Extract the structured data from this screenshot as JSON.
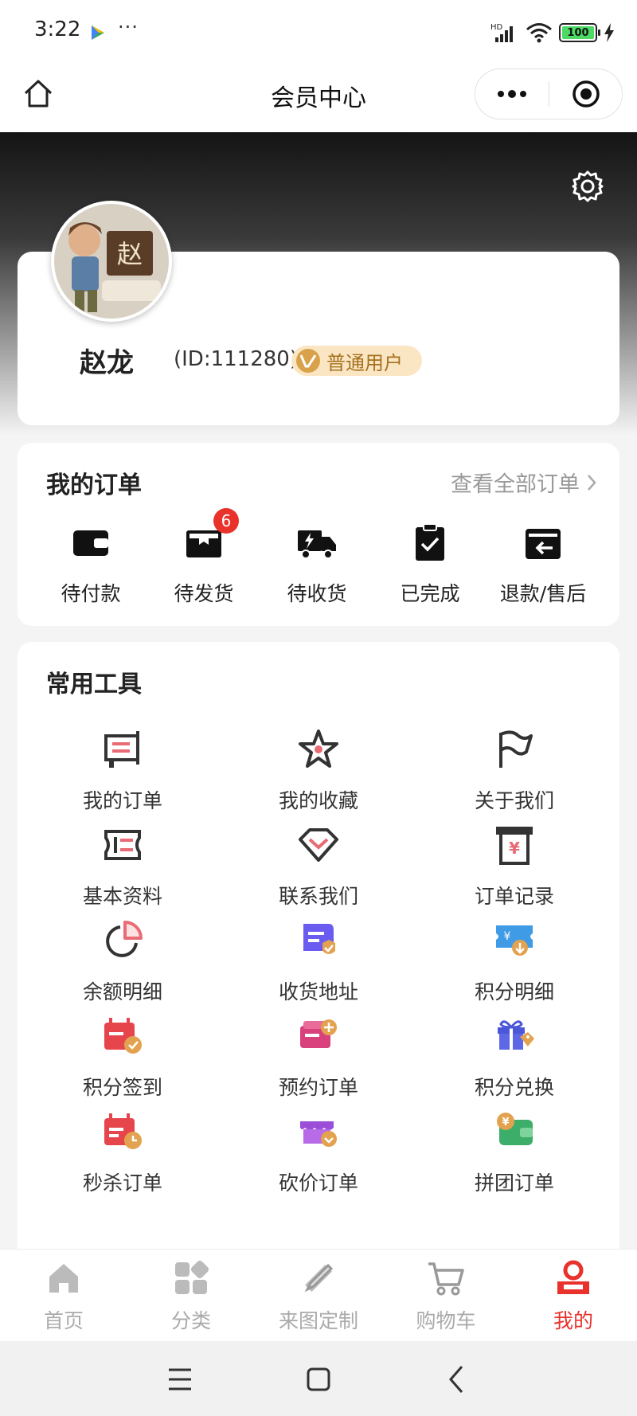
{
  "status_bar": {
    "time": "3:22",
    "dots": "···",
    "network": "HD",
    "battery": "100"
  },
  "nav": {
    "title": "会员中心"
  },
  "user": {
    "name": "赵龙",
    "id": "(ID:111280)",
    "level": "普通用户",
    "avatar_char": "赵"
  },
  "orders": {
    "title": "我的订单",
    "view_all": "查看全部订单",
    "items": [
      {
        "label": "待付款",
        "icon": "wallet-icon"
      },
      {
        "label": "待发货",
        "icon": "box-icon",
        "badge": "6"
      },
      {
        "label": "待收货",
        "icon": "truck-icon"
      },
      {
        "label": "已完成",
        "icon": "clipboard-check-icon"
      },
      {
        "label": "退款/售后",
        "icon": "return-icon"
      }
    ]
  },
  "tools": {
    "title": "常用工具",
    "items": [
      {
        "label": "我的订单",
        "icon": "cart-order-icon"
      },
      {
        "label": "我的收藏",
        "icon": "star-icon"
      },
      {
        "label": "关于我们",
        "icon": "flag-icon"
      },
      {
        "label": "基本资料",
        "icon": "id-card-icon"
      },
      {
        "label": "联系我们",
        "icon": "diamond-icon"
      },
      {
        "label": "订单记录",
        "icon": "receipt-icon"
      },
      {
        "label": "余额明细",
        "icon": "pie-chart-icon"
      },
      {
        "label": "收货地址",
        "icon": "address-icon"
      },
      {
        "label": "积分明细",
        "icon": "ticket-icon"
      },
      {
        "label": "积分签到",
        "icon": "calendar-check-icon"
      },
      {
        "label": "预约订单",
        "icon": "card-plus-icon"
      },
      {
        "label": "积分兑换",
        "icon": "gift-icon"
      },
      {
        "label": "秒杀订单",
        "icon": "calendar-clock-icon"
      },
      {
        "label": "砍价订单",
        "icon": "store-icon"
      },
      {
        "label": "拼团订单",
        "icon": "wallet-coin-icon"
      }
    ]
  },
  "tabs": [
    {
      "label": "首页",
      "icon": "home-icon"
    },
    {
      "label": "分类",
      "icon": "grid-icon"
    },
    {
      "label": "来图定制",
      "icon": "pencil-ruler-icon"
    },
    {
      "label": "购物车",
      "icon": "cart-icon"
    },
    {
      "label": "我的",
      "icon": "user-icon",
      "active": true
    }
  ],
  "colors": {
    "accent": "#e8322b",
    "gold_badge": "#fbe6c3",
    "gold_text": "#a5711e"
  }
}
